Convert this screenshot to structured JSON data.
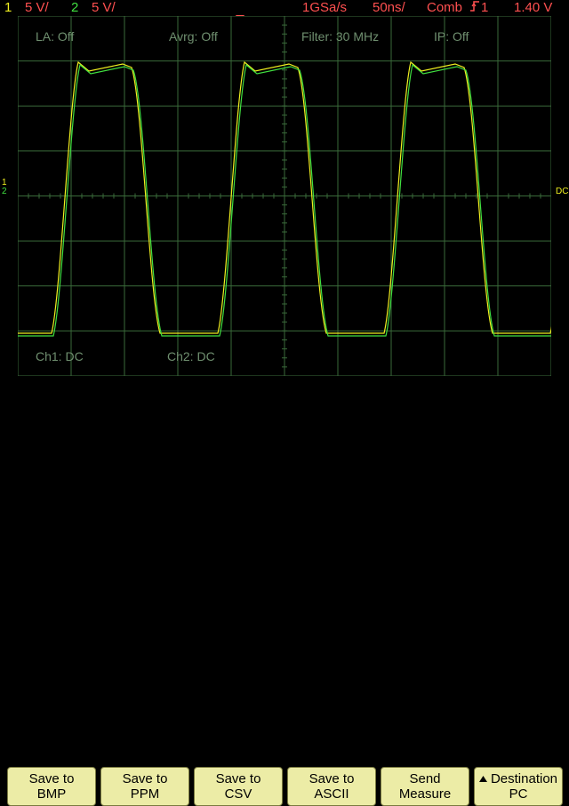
{
  "top_bar": {
    "ch1_index": "1",
    "ch1_scale": "5 V/",
    "ch2_index": "2",
    "ch2_scale": "5 V/",
    "sample_rate": "1GSa/s",
    "timebase": "50ns/",
    "trigger_mode": "Comb",
    "trigger_source": "1",
    "trigger_level": "1.40 V"
  },
  "overlay": {
    "la": "LA: Off",
    "avrg": "Avrg: Off",
    "filter": "Filter: 30 MHz",
    "ip": "IP: Off",
    "ch1_coupling": "Ch1: DC",
    "ch2_coupling": "Ch2: DC"
  },
  "markers": {
    "left_ch1": "1",
    "left_ch2": "2",
    "right_coupling": "DC"
  },
  "softkeys": [
    {
      "line1": "Save to",
      "line2": "BMP"
    },
    {
      "line1": "Save to",
      "line2": "PPM"
    },
    {
      "line1": "Save to",
      "line2": "CSV"
    },
    {
      "line1": "Save to",
      "line2": "ASCII"
    },
    {
      "line1": "Send",
      "line2": "Measure"
    },
    {
      "line1": "Destination",
      "line2": "PC"
    }
  ],
  "colors": {
    "ch1": "#f0f020",
    "ch2": "#40e040",
    "status": "#ff5050",
    "grid": "#3a6a3a",
    "softkey_bg": "#ececa6"
  },
  "icons": {
    "trigger_edge": "rising-edge-icon",
    "trigger_position": "trigger-position-marker-icon",
    "destination_arrow": "triangle-up-icon"
  }
}
